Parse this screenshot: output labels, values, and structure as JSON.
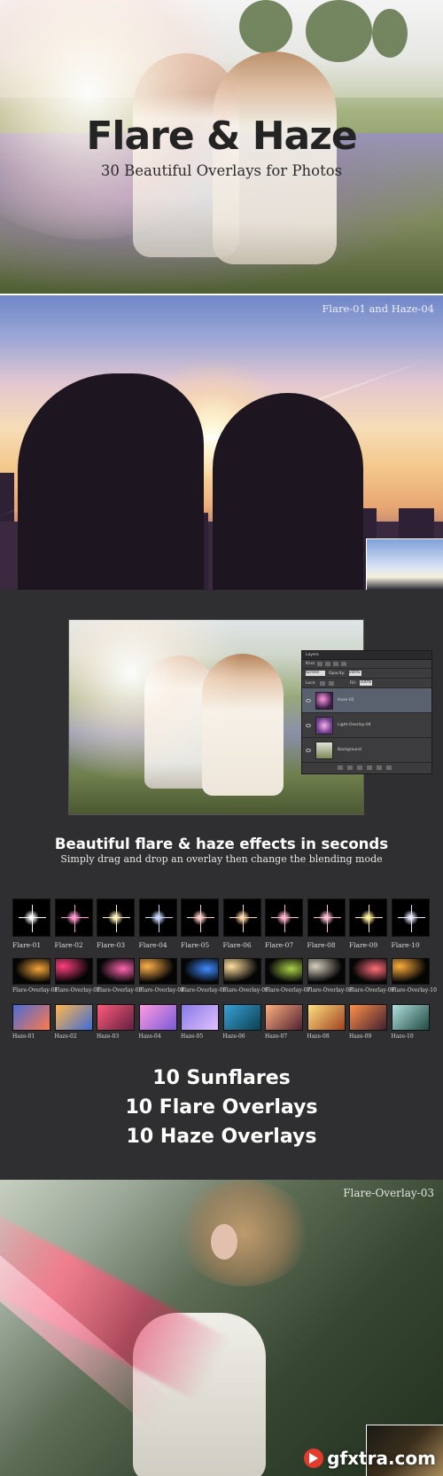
{
  "hero": {
    "title": "Flare & Haze",
    "subtitle": "30 Beautiful Overlays for Photos"
  },
  "sunset": {
    "label": "Flare-01 and Haze-04"
  },
  "editor": {
    "layers_panel": {
      "tab": "Layers",
      "kind": "Kind",
      "blend_mode": "Screen",
      "opacity_label": "Opacity:",
      "opacity_value": "100%",
      "lock_label": "Lock:",
      "fill_label": "Fill:",
      "fill_value": "100%",
      "layers": [
        "Haze-02",
        "Light-Overlay-04",
        "Background"
      ]
    },
    "headline": "Beautiful flare & haze effects in seconds",
    "subline": "Simply drag and drop an overlay then change the blending mode"
  },
  "flares": [
    "Flare-01",
    "Flare-02",
    "Flare-03",
    "Flare-04",
    "Flare-05",
    "Flare-06",
    "Flare-07",
    "Flare-08",
    "Flare-09",
    "Flare-10"
  ],
  "flare_overlays": [
    "Flare-Overlay-01",
    "Flare-Overlay-02",
    "Flare-Overlay-03",
    "Flare-Overlay-04",
    "Flare-Overlay-05",
    "Flare-Overlay-06",
    "Flare-Overlay-07",
    "Flare-Overlay-08",
    "Flare-Overlay-09",
    "Flare-Overlay-10"
  ],
  "hazes": [
    "Haze-01",
    "Haze-02",
    "Haze-03",
    "Haze-04",
    "Haze-05",
    "Haze-06",
    "Haze-07",
    "Haze-08",
    "Haze-09",
    "Haze-10"
  ],
  "counts": [
    "10 Sunflares",
    "10 Flare Overlays",
    "10 Haze Overlays"
  ],
  "girl": {
    "label": "Flare-Overlay-03"
  },
  "watermark": "gfxtra.com",
  "colors": {
    "flare_tints": [
      "#ffffff",
      "#ff9ad0",
      "#fff2c0",
      "#c9d8ff",
      "#ffd0c8",
      "#ffd7ae",
      "#ffb8d0",
      "#ffc0d8",
      "#fff0a0",
      "#e8eaff"
    ],
    "overlay_tints": [
      "#f5a63a",
      "#ff3f7e",
      "#ff66b0",
      "#ffb14a",
      "#3f8bff",
      "#ffe0a0",
      "#a8d048",
      "#d8d0c0",
      "#ff6e7a",
      "#ffae3c"
    ],
    "haze_tints": [
      [
        "#4a6bd8",
        "#ff7a4a"
      ],
      [
        "#ffb84a",
        "#3f6ad8"
      ],
      [
        "#ff5a7a",
        "#602040"
      ],
      [
        "#ff9ae0",
        "#7a5ad8"
      ],
      [
        "#8a7ae8",
        "#e0c0ff"
      ],
      [
        "#3aa0d8",
        "#0a4050"
      ],
      [
        "#ffb080",
        "#502030"
      ],
      [
        "#ffe080",
        "#a04020"
      ],
      [
        "#ff9048",
        "#402030"
      ],
      [
        "#b0e0e0",
        "#204840"
      ]
    ]
  }
}
